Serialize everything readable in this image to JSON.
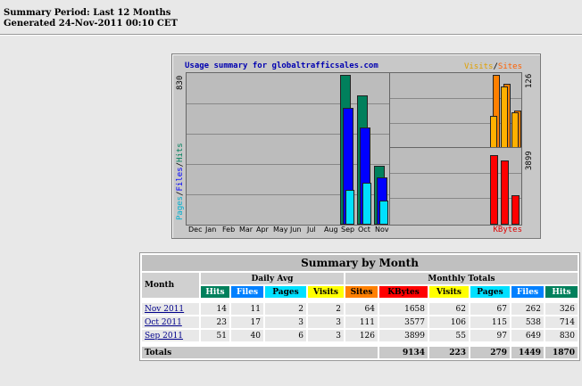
{
  "header": {
    "summary_period": "Summary Period: Last 12 Months",
    "generated": "Generated 24-Nov-2011 00:10 CET"
  },
  "usage_chart": {
    "title": "Usage summary for globaltrafficsales.com",
    "left_axis_label": {
      "pages": "Pages",
      "files": "Files",
      "hits": "Hits",
      "sep": "/"
    },
    "left_max_label": "830",
    "visits_label": "Visits",
    "sites_label": "Sites",
    "right_top_max": "126",
    "right_bottom_max": "3899",
    "kbytes_label": "KBytes",
    "months": [
      "Dec",
      "Jan",
      "Feb",
      "Mar",
      "Apr",
      "May",
      "Jun",
      "Jul",
      "Aug",
      "Sep",
      "Oct",
      "Nov"
    ],
    "colors": {
      "hits": "#00805c",
      "files": "#0000ff",
      "pages": "#00e0ff",
      "visits": "#ffb000",
      "sites": "#ff8000",
      "kbytes": "#ff0000"
    }
  },
  "chart_data": {
    "type": "bar",
    "categories": [
      "Dec",
      "Jan",
      "Feb",
      "Mar",
      "Apr",
      "May",
      "Jun",
      "Jul",
      "Aug",
      "Sep",
      "Oct",
      "Nov"
    ],
    "series": [
      {
        "name": "Hits",
        "values": [
          0,
          0,
          0,
          0,
          0,
          0,
          0,
          0,
          0,
          830,
          714,
          326
        ]
      },
      {
        "name": "Files",
        "values": [
          0,
          0,
          0,
          0,
          0,
          0,
          0,
          0,
          0,
          649,
          538,
          262
        ]
      },
      {
        "name": "Pages",
        "values": [
          0,
          0,
          0,
          0,
          0,
          0,
          0,
          0,
          0,
          97,
          115,
          67
        ]
      },
      {
        "name": "Visits",
        "values": [
          0,
          0,
          0,
          0,
          0,
          0,
          0,
          0,
          0,
          55,
          106,
          62
        ]
      },
      {
        "name": "Sites",
        "values": [
          0,
          0,
          0,
          0,
          0,
          0,
          0,
          0,
          0,
          126,
          111,
          64
        ]
      },
      {
        "name": "KBytes",
        "values": [
          0,
          0,
          0,
          0,
          0,
          0,
          0,
          0,
          0,
          3899,
          3577,
          1658
        ]
      }
    ],
    "title": "Usage summary for globaltrafficsales.com",
    "ylim_left": [
      0,
      830
    ],
    "ylim_right_top": [
      0,
      126
    ],
    "ylim_right_bottom": [
      0,
      3899
    ]
  },
  "summary": {
    "title": "Summary by Month",
    "month_header": "Month",
    "daily_avg_header": "Daily Avg",
    "monthly_totals_header": "Monthly Totals",
    "daily_cols": [
      "Hits",
      "Files",
      "Pages",
      "Visits"
    ],
    "monthly_cols": [
      "Sites",
      "KBytes",
      "Visits",
      "Pages",
      "Files",
      "Hits"
    ],
    "rows": [
      {
        "month": "Nov 2011",
        "daily": [
          "14",
          "11",
          "2",
          "2"
        ],
        "monthly": [
          "64",
          "1658",
          "62",
          "67",
          "262",
          "326"
        ]
      },
      {
        "month": "Oct 2011",
        "daily": [
          "23",
          "17",
          "3",
          "3"
        ],
        "monthly": [
          "111",
          "3577",
          "106",
          "115",
          "538",
          "714"
        ]
      },
      {
        "month": "Sep 2011",
        "daily": [
          "51",
          "40",
          "6",
          "3"
        ],
        "monthly": [
          "126",
          "3899",
          "55",
          "97",
          "649",
          "830"
        ]
      }
    ],
    "totals_label": "Totals",
    "totals": [
      "9134",
      "223",
      "279",
      "1449",
      "1870"
    ]
  }
}
